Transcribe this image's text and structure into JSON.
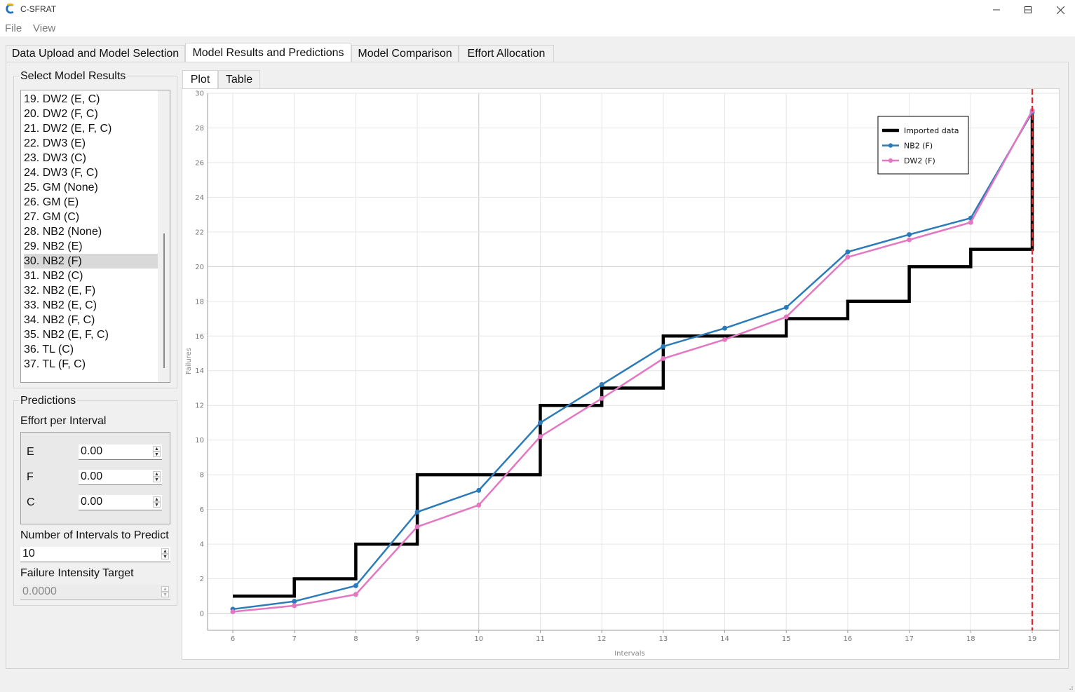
{
  "window": {
    "title": "C-SFRAT"
  },
  "menu": {
    "file": "File",
    "view": "View"
  },
  "tabs": [
    "Data Upload and Model Selection",
    "Model Results and Predictions",
    "Model Comparison",
    "Effort Allocation"
  ],
  "select_model": {
    "title": "Select Model Results",
    "items": [
      "19. DW2 (E, C)",
      "20. DW2 (F, C)",
      "21. DW2 (E, F, C)",
      "22. DW3 (E)",
      "23. DW3 (C)",
      "24. DW3 (F, C)",
      "25. GM (None)",
      "26. GM (E)",
      "27. GM (C)",
      "28. NB2 (None)",
      "29. NB2 (E)",
      "30. NB2 (F)",
      "31. NB2 (C)",
      "32. NB2 (E, F)",
      "33. NB2 (E, C)",
      "34. NB2 (F, C)",
      "35. NB2 (E, F, C)",
      "36. TL (C)",
      "37. TL (F, C)"
    ],
    "selected": "30. NB2 (F)"
  },
  "predictions": {
    "title": "Predictions",
    "effort_label": "Effort per Interval",
    "efforts": [
      {
        "name": "E",
        "value": "0.00"
      },
      {
        "name": "F",
        "value": "0.00"
      },
      {
        "name": "C",
        "value": "0.00"
      }
    ],
    "intervals_label": "Number of Intervals to Predict",
    "intervals_value": "10",
    "intensity_label": "Failure Intensity Target",
    "intensity_value": "0.0000"
  },
  "subtabs": [
    "Plot",
    "Table"
  ],
  "colors": {
    "imported": "#000000",
    "nb2": "#2b7bb9",
    "dw2": "#e377c2",
    "vline": "#e8232b"
  },
  "chart_data": {
    "type": "line",
    "xlabel": "Intervals",
    "ylabel": "Failures",
    "xlim": [
      6,
      19
    ],
    "ylim": [
      0,
      30
    ],
    "xticks": [
      6,
      7,
      8,
      9,
      10,
      11,
      12,
      13,
      14,
      15,
      16,
      17,
      18,
      19
    ],
    "yticks": [
      0,
      2,
      4,
      6,
      8,
      10,
      12,
      14,
      16,
      18,
      20,
      22,
      24,
      26,
      28,
      30
    ],
    "grid": true,
    "legend_position": "top-right",
    "series": [
      {
        "name": "Imported data",
        "style": "step",
        "x": [
          6,
          7,
          8,
          9,
          10,
          11,
          12,
          13,
          14,
          15,
          16,
          17,
          18,
          19,
          19
        ],
        "y": [
          1,
          2,
          4,
          8,
          8,
          12,
          13,
          16,
          16,
          17,
          18,
          20,
          21,
          21,
          29
        ]
      },
      {
        "name": "NB2 (F)",
        "style": "line-marker",
        "x": [
          6,
          7,
          8,
          9,
          10,
          11,
          12,
          13,
          14,
          15,
          16,
          17,
          18,
          19
        ],
        "y": [
          0.25,
          0.7,
          1.6,
          5.85,
          7.1,
          11.0,
          13.2,
          15.4,
          16.45,
          17.65,
          20.85,
          21.85,
          22.8,
          28.9
        ]
      },
      {
        "name": "DW2 (F)",
        "style": "line-marker",
        "x": [
          6,
          7,
          8,
          9,
          10,
          11,
          12,
          13,
          14,
          15,
          16,
          17,
          18,
          19
        ],
        "y": [
          0.1,
          0.45,
          1.1,
          5.0,
          6.25,
          10.2,
          12.4,
          14.7,
          15.8,
          17.1,
          20.55,
          21.55,
          22.55,
          29.0
        ]
      }
    ],
    "vertical_marker": {
      "x": 19,
      "style": "dashed"
    }
  }
}
